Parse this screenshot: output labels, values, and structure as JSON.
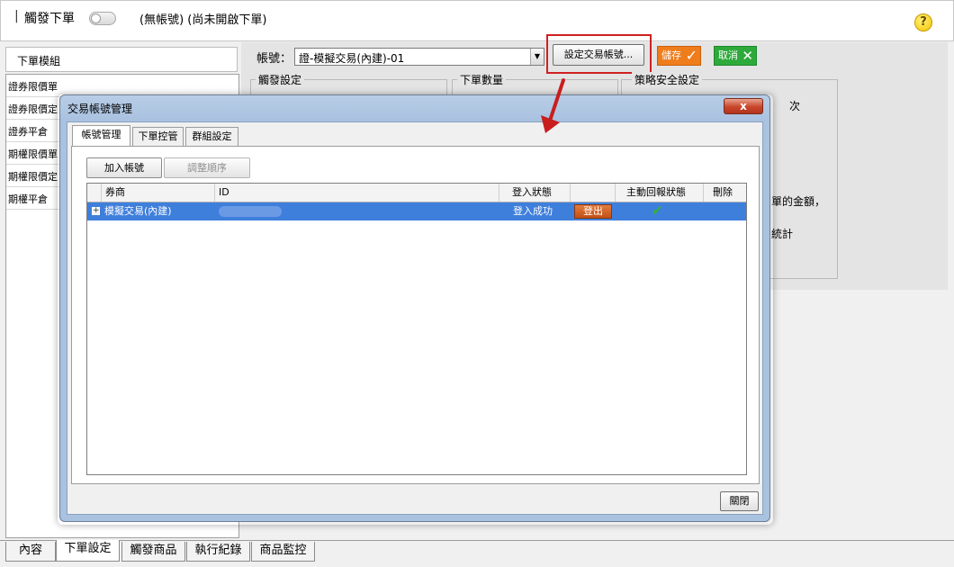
{
  "topbar": {
    "separator": "|",
    "title": "觸發下單",
    "status": "(無帳號) (尚未開啟下單)",
    "help_icon": "?"
  },
  "modules": {
    "header": "下單模組",
    "items": [
      "證券限價單",
      "證券限價定",
      "證券平倉",
      "期權限價單",
      "期權限價定",
      "期權平倉"
    ]
  },
  "account": {
    "label": "帳號：",
    "selected": "證-模擬交易(內建)-01",
    "set_button": "設定交易帳號...",
    "save_button": "儲存",
    "cancel_button": "取消"
  },
  "sections": {
    "trigger": "觸發設定",
    "quantity": "下單數量",
    "safety": "策略安全設定",
    "times_unit": "次",
    "fragment_1": "單的金額，",
    "fragment_2": "統計"
  },
  "bottom_tabs": [
    "內容",
    "下單設定",
    "觸發商品",
    "執行紀錄",
    "商品監控"
  ],
  "dialog": {
    "title": "交易帳號管理",
    "close_symbol": "x",
    "tabs": [
      "帳號管理",
      "下單控管",
      "群組設定"
    ],
    "add_button": "加入帳號",
    "reorder_button": "調整順序",
    "columns": [
      "券商",
      "ID",
      "登入狀態",
      "",
      "主動回報狀態",
      "刪除"
    ],
    "row": {
      "expand": "+",
      "broker": "模擬交易(內建)",
      "login_status": "登入成功",
      "logout_button": "登出"
    },
    "close_button": "關閉"
  },
  "colors": {
    "selection": "#3f7fdc",
    "save": "#ef7d1c",
    "cancel": "#2eaa3a",
    "highlight": "#d02020"
  }
}
